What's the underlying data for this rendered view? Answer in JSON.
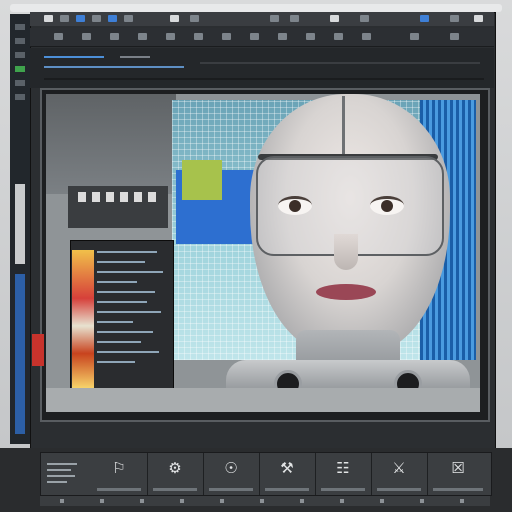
{
  "screen": {
    "description_free": true,
    "accent_color": "#3e7fd6",
    "bezel_color": "#d9dadb",
    "window_color": "#2b2e31"
  },
  "toolbar": {
    "row1_icons": [
      "menu-icon",
      "file-icon",
      "edit-icon",
      "view-icon",
      "render-icon",
      "window-icon",
      "help-icon",
      "settings-icon"
    ],
    "row2_icons": [
      "move-icon",
      "rotate-icon",
      "scale-icon",
      "select-icon",
      "camera-icon",
      "light-icon",
      "mesh-icon",
      "material-icon",
      "texture-icon",
      "play-icon",
      "pause-icon",
      "stop-icon"
    ]
  },
  "viewport": {
    "content": "3d-render-preview"
  },
  "bottom_panel": {
    "tools": [
      {
        "icon": "⚐",
        "name": "layers-tool"
      },
      {
        "icon": "⚙",
        "name": "gear-tool"
      },
      {
        "icon": "☉",
        "name": "sun-tool"
      },
      {
        "icon": "⚒",
        "name": "build-tool"
      },
      {
        "icon": "☷",
        "name": "grid-tool"
      },
      {
        "icon": "⚔",
        "name": "node-tool"
      },
      {
        "icon": "☒",
        "name": "export-tool"
      }
    ]
  }
}
